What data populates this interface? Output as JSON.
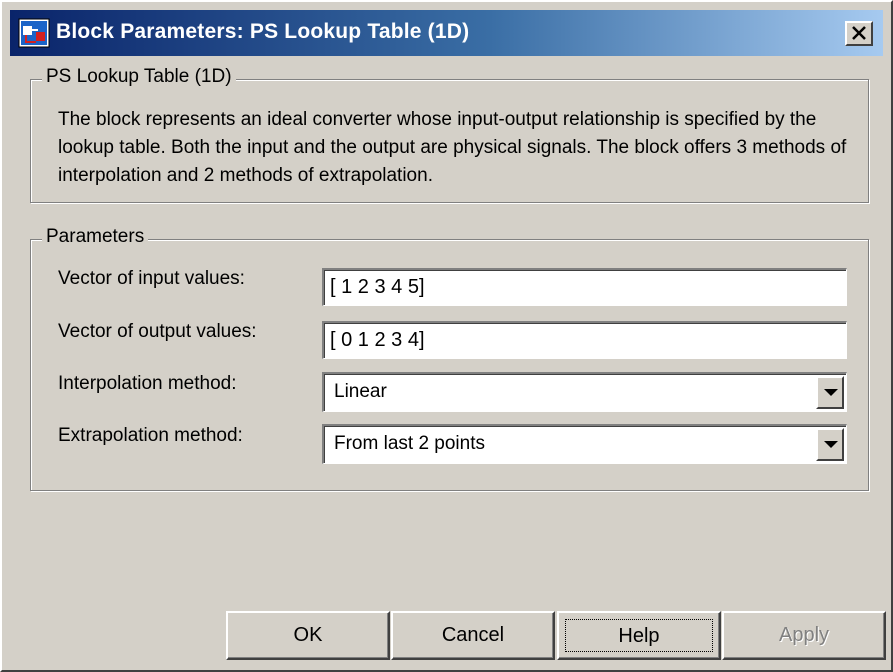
{
  "window": {
    "title": "Block Parameters: PS Lookup Table (1D)",
    "close_label": "close"
  },
  "description_group": {
    "legend": "PS Lookup Table (1D)",
    "text": "The block represents an ideal converter whose input-output relationship is specified by the lookup table. Both the input and the output are physical signals. The block offers 3 methods of interpolation and 2 methods of extrapolation."
  },
  "parameters": {
    "legend": "Parameters",
    "input_values": {
      "label": "Vector of input values:",
      "value": "[ 1 2 3 4 5]"
    },
    "output_values": {
      "label": "Vector of output values:",
      "value": "[ 0 1 2 3 4]"
    },
    "interpolation": {
      "label": "Interpolation method:",
      "selected": "Linear"
    },
    "extrapolation": {
      "label": "Extrapolation method:",
      "selected": "From last 2 points"
    }
  },
  "buttons": {
    "ok": "OK",
    "cancel": "Cancel",
    "help": "Help",
    "apply": "Apply"
  },
  "colors": {
    "face": "#d4d0c8",
    "title_start": "#0a246a",
    "title_end": "#a6caf0",
    "disabled_text": "#808080"
  }
}
